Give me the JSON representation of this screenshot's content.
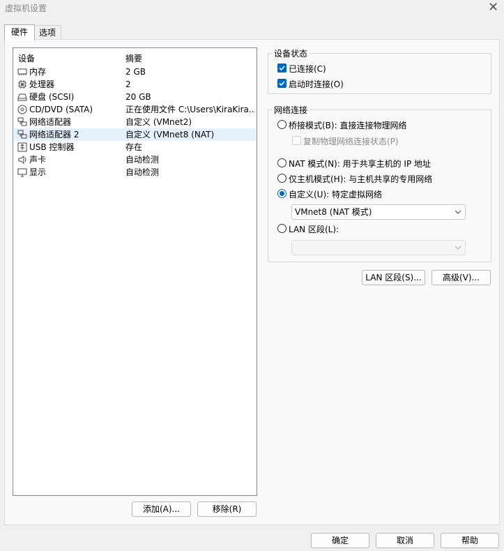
{
  "window": {
    "title": "虚拟机设置"
  },
  "tabs": [
    {
      "label": "硬件",
      "active": true
    },
    {
      "label": "选项",
      "active": false
    }
  ],
  "device_list": {
    "headers": {
      "device": "设备",
      "summary": "摘要"
    },
    "rows": [
      {
        "icon": "memory-icon",
        "name": "内存",
        "summary": "2 GB"
      },
      {
        "icon": "processor-icon",
        "name": "处理器",
        "summary": "2"
      },
      {
        "icon": "hard-disk-icon",
        "name": "硬盘 (SCSI)",
        "summary": "20 GB"
      },
      {
        "icon": "cd-dvd-icon",
        "name": "CD/DVD (SATA)",
        "summary": "正在使用文件 C:\\Users\\KiraKira..."
      },
      {
        "icon": "network-adapter-icon",
        "name": "网络适配器",
        "summary": "自定义 (VMnet2)"
      },
      {
        "icon": "network-adapter-icon",
        "name": "网络适配器 2",
        "summary": "自定义 (VMnet8 (NAT)",
        "selected": true
      },
      {
        "icon": "usb-icon",
        "name": "USB 控制器",
        "summary": "存在"
      },
      {
        "icon": "sound-card-icon",
        "name": "声卡",
        "summary": "自动检测"
      },
      {
        "icon": "display-icon",
        "name": "显示",
        "summary": "自动检测"
      }
    ]
  },
  "list_buttons": {
    "add": "添加(A)...",
    "remove": "移除(R)"
  },
  "device_status": {
    "title": "设备状态",
    "connected": {
      "label": "已连接(C)",
      "checked": true
    },
    "connect_at_power_on": {
      "label": "启动时连接(O)",
      "checked": true
    }
  },
  "network_connection": {
    "title": "网络连接",
    "bridged": {
      "label": "桥接模式(B): 直接连接物理网络",
      "checked": false
    },
    "replicate": {
      "label": "复制物理网络连接状态(P)",
      "checked": false
    },
    "nat": {
      "label": "NAT 模式(N): 用于共享主机的 IP 地址",
      "checked": false
    },
    "host_only": {
      "label": "仅主机模式(H): 与主机共享的专用网络",
      "checked": false
    },
    "custom": {
      "label": "自定义(U): 特定虚拟网络",
      "checked": true
    },
    "custom_select": {
      "value": "VMnet8 (NAT 模式)"
    },
    "lan_segment": {
      "label": "LAN 区段(L):",
      "checked": false
    },
    "lan_select": {
      "value": ""
    }
  },
  "net_buttons": {
    "lan_segments": "LAN 区段(S)...",
    "advanced": "高级(V)..."
  },
  "footer_buttons": {
    "ok": "确定",
    "cancel": "取消",
    "help": "帮助"
  },
  "colors": {
    "accent": "#0067c0",
    "selection": "#e5f1fb"
  }
}
